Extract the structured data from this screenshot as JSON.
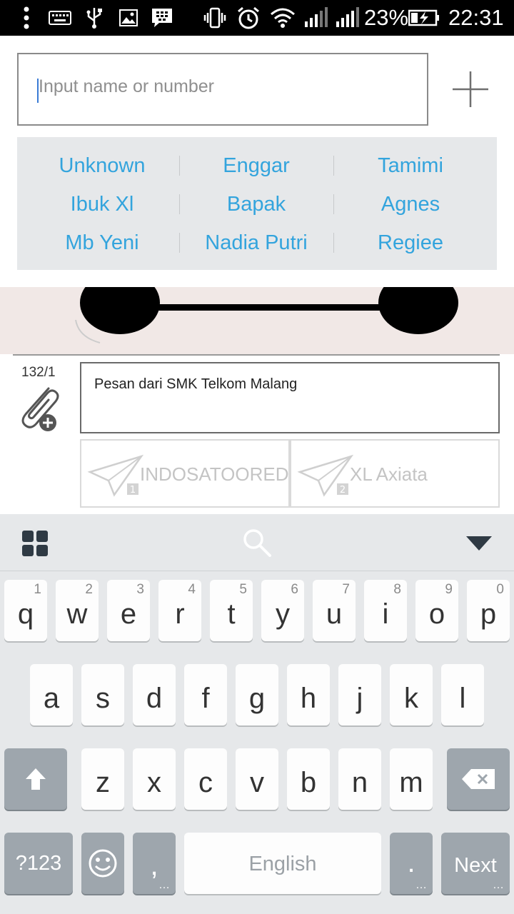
{
  "status_bar": {
    "battery_percent": "23%",
    "time": "22:31",
    "icons": [
      "menu-dots-icon",
      "keyboard-icon",
      "usb-icon",
      "image-icon",
      "bbm-icon",
      "vibrate-icon",
      "alarm-icon",
      "wifi-icon",
      "signal-1-icon",
      "signal-2-icon",
      "battery-charging-icon"
    ]
  },
  "recipient": {
    "placeholder": "Input name or number",
    "add_icon": "plus-icon"
  },
  "suggestions": [
    [
      "Unknown",
      "Enggar",
      "Tamimi"
    ],
    [
      "Ibuk  Xl",
      "Bapak",
      "Agnes"
    ],
    [
      "Mb Yeni",
      "Nadia Putri",
      "Regiee"
    ]
  ],
  "compose": {
    "counter": "132/1",
    "attach_icon": "paperclip-add-icon",
    "message": "Pesan dari SMK Telkom Malang",
    "send_buttons": [
      {
        "label": "INDOSATOOREDOO",
        "sim": "1"
      },
      {
        "label": "XL Axiata",
        "sim": "2"
      }
    ]
  },
  "keyboard": {
    "toolbar": {
      "left_icon": "grid-icon",
      "center_icon": "search-icon",
      "right_icon": "collapse-triangle-icon"
    },
    "row1": [
      {
        "k": "q",
        "h": "1"
      },
      {
        "k": "w",
        "h": "2"
      },
      {
        "k": "e",
        "h": "3"
      },
      {
        "k": "r",
        "h": "4"
      },
      {
        "k": "t",
        "h": "5"
      },
      {
        "k": "y",
        "h": "6"
      },
      {
        "k": "u",
        "h": "7"
      },
      {
        "k": "i",
        "h": "8"
      },
      {
        "k": "o",
        "h": "9"
      },
      {
        "k": "p",
        "h": "0"
      }
    ],
    "row2": [
      "a",
      "s",
      "d",
      "f",
      "g",
      "h",
      "j",
      "k",
      "l"
    ],
    "row3": [
      "z",
      "x",
      "c",
      "v",
      "b",
      "n",
      "m"
    ],
    "sym_label": "?123",
    "comma_label": ",",
    "space_label": "English",
    "period_label": ".",
    "next_label": "Next",
    "more": "…",
    "colors": {
      "background": "#e6e8ea",
      "key": "#fdfdfd",
      "dark_key": "#9ea6ad",
      "accent": "#33a4dd"
    }
  }
}
